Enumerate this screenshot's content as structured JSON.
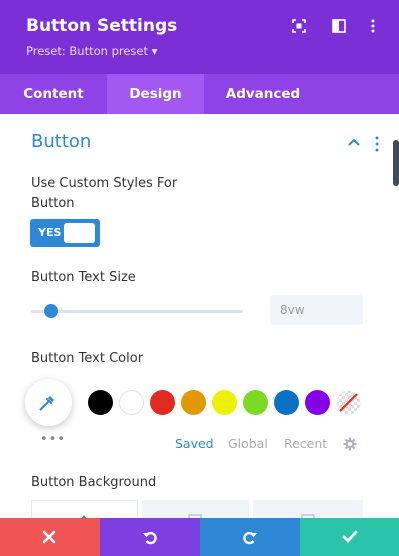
{
  "header": {
    "title": "Button Settings",
    "preset": "Preset: Button preset ▾",
    "icons": [
      "focus-mode-icon",
      "split-view-icon",
      "more-options-icon"
    ]
  },
  "tabs": [
    {
      "label": "Content",
      "active": false
    },
    {
      "label": "Design",
      "active": true
    },
    {
      "label": "Advanced",
      "active": false
    }
  ],
  "section": {
    "title": "Button"
  },
  "custom_styles": {
    "label": "Use Custom Styles For Button",
    "toggle_label": "YES",
    "enabled": true
  },
  "text_size": {
    "label": "Button Text Size",
    "value": "8vw"
  },
  "text_color": {
    "label": "Button Text Color",
    "swatches": [
      "#000000",
      "#ffffff",
      "#e02b20",
      "#e09900",
      "#edf000",
      "#7cda24",
      "#0c71c3",
      "#8300e9",
      "transparent"
    ],
    "more": "•••",
    "color_tabs": [
      "Saved",
      "Global",
      "Recent"
    ],
    "active_color_tab": "Saved"
  },
  "background": {
    "label": "Button Background"
  },
  "footer": {
    "buttons": [
      {
        "name": "discard",
        "color": "#ef5555"
      },
      {
        "name": "undo",
        "color": "#7f3fe0"
      },
      {
        "name": "redo",
        "color": "#2e88d6"
      },
      {
        "name": "save",
        "color": "#29c4a9"
      }
    ]
  },
  "colors": {
    "header": "#7b2fd6",
    "tab_bar": "#8f42e6",
    "tab_active": "#a358f2",
    "accent": "#2e88d6"
  }
}
